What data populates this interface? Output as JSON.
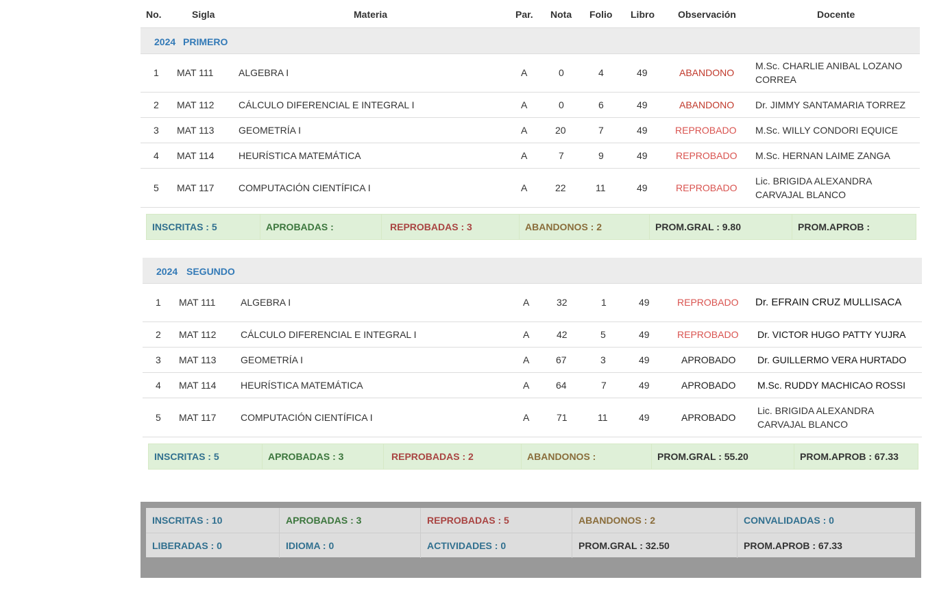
{
  "headers": {
    "no": "No.",
    "sigla": "Sigla",
    "materia": "Materia",
    "par": "Par.",
    "nota": "Nota",
    "folio": "Folio",
    "libro": "Libro",
    "observacion": "Observación",
    "docente": "Docente"
  },
  "periods": [
    {
      "year": "2024",
      "name": "PRIMERO",
      "rows": [
        {
          "no": "1",
          "sigla": "MAT 111",
          "materia": "ALGEBRA I",
          "par": "A",
          "nota": "0",
          "folio": "4",
          "libro": "49",
          "obs": "ABANDONO",
          "docente": "M.Sc. CHARLIE ANIBAL LOZANO CORREA"
        },
        {
          "no": "2",
          "sigla": "MAT 112",
          "materia": "CÁLCULO DIFERENCIAL E INTEGRAL I",
          "par": "A",
          "nota": "0",
          "folio": "6",
          "libro": "49",
          "obs": "ABANDONO",
          "docente": "Dr. JIMMY SANTAMARIA TORREZ"
        },
        {
          "no": "3",
          "sigla": "MAT 113",
          "materia": "GEOMETRÍA I",
          "par": "A",
          "nota": "20",
          "folio": "7",
          "libro": "49",
          "obs": "REPROBADO",
          "docente": "M.Sc. WILLY CONDORI EQUICE"
        },
        {
          "no": "4",
          "sigla": "MAT 114",
          "materia": "HEURÍSTICA MATEMÁTICA",
          "par": "A",
          "nota": "7",
          "folio": "9",
          "libro": "49",
          "obs": "REPROBADO",
          "docente": "M.Sc. HERNAN LAIME ZANGA"
        },
        {
          "no": "5",
          "sigla": "MAT 117",
          "materia": "COMPUTACIÓN CIENTÍFICA I",
          "par": "A",
          "nota": "22",
          "folio": "11",
          "libro": "49",
          "obs": "REPROBADO",
          "docente": "Lic. BRIGIDA ALEXANDRA CARVAJAL BLANCO"
        }
      ],
      "summary": {
        "inscritas": "INSCRITAS  :  5",
        "aprobadas": "APROBADAS  :",
        "reprobadas": "REPROBADAS  :  3",
        "abandonos": "ABANDONOS  :  2",
        "prom_gral": "PROM.GRAL  :  9.80",
        "prom_aprob": "PROM.APROB :"
      }
    },
    {
      "year": "2024",
      "name": "SEGUNDO",
      "rows": [
        {
          "no": "1",
          "sigla": "MAT 111",
          "materia": "ALGEBRA I",
          "par": "A",
          "nota": "32",
          "folio": "1",
          "libro": "49",
          "obs": "REPROBADO",
          "docente": "Dr. EFRAIN CRUZ MULLISACA"
        },
        {
          "no": "2",
          "sigla": "MAT 112",
          "materia": "CÁLCULO DIFERENCIAL E INTEGRAL I",
          "par": "A",
          "nota": "42",
          "folio": "5",
          "libro": "49",
          "obs": "REPROBADO",
          "docente": "Dr. VICTOR HUGO PATTY YUJRA"
        },
        {
          "no": "3",
          "sigla": "MAT 113",
          "materia": "GEOMETRÍA I",
          "par": "A",
          "nota": "67",
          "folio": "3",
          "libro": "49",
          "obs": "APROBADO",
          "docente": "Dr. GUILLERMO VERA HURTADO"
        },
        {
          "no": "4",
          "sigla": "MAT 114",
          "materia": "HEURÍSTICA MATEMÁTICA",
          "par": "A",
          "nota": "64",
          "folio": "7",
          "libro": "49",
          "obs": "APROBADO",
          "docente": "M.Sc. RUDDY MACHICAO ROSSI"
        },
        {
          "no": "5",
          "sigla": "MAT 117",
          "materia": "COMPUTACIÓN CIENTÍFICA I",
          "par": "A",
          "nota": "71",
          "folio": "11",
          "libro": "49",
          "obs": "APROBADO",
          "docente": "Lic. BRIGIDA ALEXANDRA CARVAJAL BLANCO"
        }
      ],
      "summary": {
        "inscritas": "INSCRITAS  :  5",
        "aprobadas": "APROBADAS  :  3",
        "reprobadas": "REPROBADAS  :  2",
        "abandonos": "ABANDONOS  :",
        "prom_gral": "PROM.GRAL  :  55.20",
        "prom_aprob": "PROM.APROB  :  67.33"
      }
    }
  ],
  "totals": {
    "inscritas": "INSCRITAS  :  10",
    "aprobadas": "APROBADAS  :  3",
    "reprobadas": "REPROBADAS  :  5",
    "abandonos": "ABANDONOS  :  2",
    "convalidadas": "CONVALIDADAS  :  0",
    "liberadas": "LIBERADAS  :  0",
    "idioma": "IDIOMA  :  0",
    "actividades": "ACTIVIDADES  :  0",
    "prom_gral": "PROM.GRAL  :  32.50",
    "prom_aprob": "PROM.APROB  :  67.33"
  },
  "colors": {
    "abandono": "#c0392b",
    "reprobado": "#e0291f",
    "summary_bg": "#dff0d8",
    "total_bg": "#999999"
  }
}
